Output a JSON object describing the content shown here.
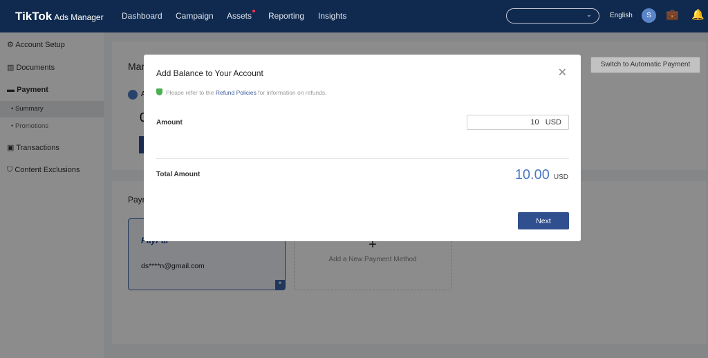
{
  "header": {
    "brand": "TikTok",
    "product": "Ads Manager",
    "nav": [
      "Dashboard",
      "Campaign",
      "Assets",
      "Reporting",
      "Insights"
    ],
    "language": "English",
    "avatar": "S"
  },
  "sidebar": {
    "items": [
      "Account Setup",
      "Documents",
      "Payment",
      "Transactions",
      "Content Exclusions"
    ],
    "sub": [
      "Summary",
      "Promotions"
    ]
  },
  "page": {
    "title_partial": "Mar",
    "section_partial": "Payr",
    "switch_button": "Switch to Automatic Payment",
    "paypal_partial": "PayPal",
    "paypal_email": "ds****n@gmail.com",
    "add_method": "Add a New Payment Method",
    "balance_partial": "0",
    "account_partial": "A"
  },
  "modal": {
    "title": "Add Balance to Your Account",
    "note_pre": "Please refer to the",
    "note_link": "Refund Policies",
    "note_post": "for information on refunds.",
    "amount_label": "Amount",
    "amount_value": "10",
    "currency": "USD",
    "total_label": "Total Amount",
    "total_value": "10.00",
    "next": "Next"
  }
}
